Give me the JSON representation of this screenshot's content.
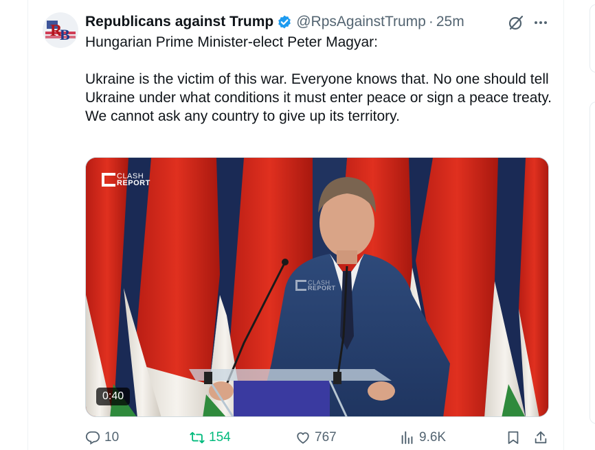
{
  "tweet": {
    "display_name": "Republicans against Trump",
    "handle": "@RpsAgainstTrump",
    "separator": "·",
    "time": "25m",
    "verified": true,
    "intro_line": "Hungarian Prime Minister-elect Peter Magyar:",
    "body": "Ukraine is the victim of this war. Everyone knows that. No one should tell Ukraine under what conditions it must enter peace or sign a peace treaty. We cannot ask any country to give up its territory.",
    "avatar_letters": "RB"
  },
  "media": {
    "duration": "0:40",
    "watermark_line1": "CLASH",
    "watermark_line2": "REPORT"
  },
  "actions": {
    "replies": "10",
    "retweets": "154",
    "likes": "767",
    "views": "9.6K"
  },
  "colors": {
    "accent_blue": "#1d9bf0",
    "retweet_green": "#00ba7c",
    "secondary_text": "#536471",
    "flag_red": "#d92a1c",
    "flag_white": "#f4f1ea",
    "flag_green": "#2f8a3c"
  },
  "icons": {
    "verified": "verified-badge-icon",
    "grok": "grok-icon",
    "more": "more-icon",
    "reply": "reply-icon",
    "retweet": "retweet-icon",
    "like": "heart-icon",
    "views": "views-icon",
    "bookmark": "bookmark-icon",
    "share": "share-icon"
  }
}
